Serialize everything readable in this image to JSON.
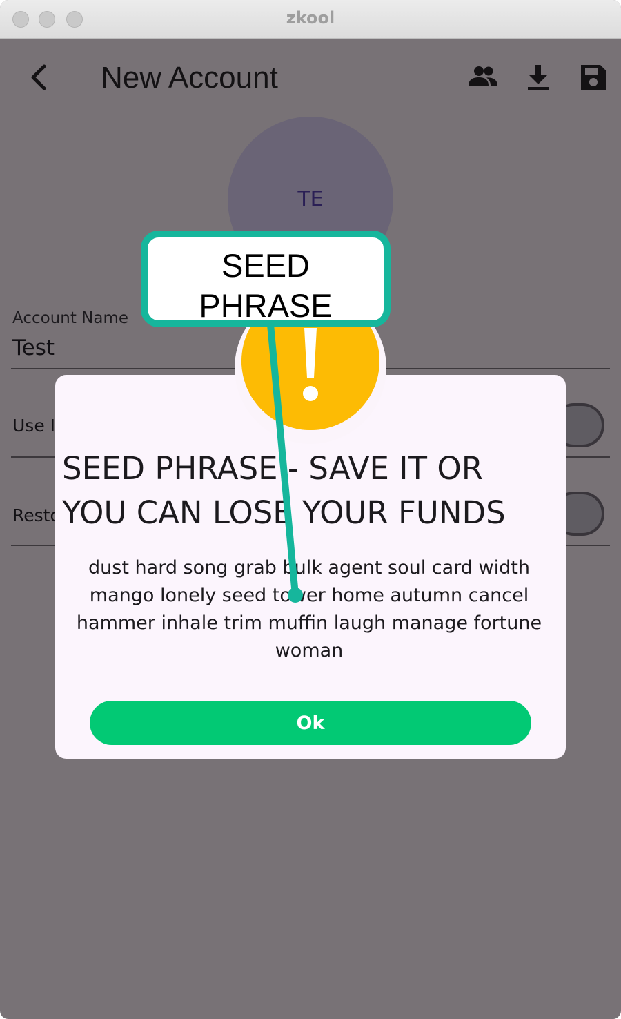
{
  "window": {
    "title": "zkool"
  },
  "appbar": {
    "title": "New Account",
    "actions": [
      "contacts-icon",
      "download-icon",
      "save-icon"
    ]
  },
  "avatar": {
    "initials": "TE"
  },
  "form": {
    "account_name_label": "Account Name",
    "account_name_value": "Test",
    "row1_label": "Use I",
    "row2_label": "Resto"
  },
  "dialog": {
    "title": "SEED PHRASE - SAVE IT OR YOU CAN LOSE YOUR FUNDS",
    "seed_phrase": "dust hard song grab bulk agent soul card width mango lonely seed tower home autumn cancel hammer inhale trim muffin laugh manage fortune woman",
    "ok_label": "Ok"
  },
  "callout": {
    "line1": "SEED",
    "line2": "PHRASE"
  },
  "colors": {
    "overlay": "#787276",
    "dialog_bg": "#fcf5fd",
    "ok_button": "#02c974",
    "warning": "#fdbb04",
    "callout_border": "#16b69c"
  }
}
